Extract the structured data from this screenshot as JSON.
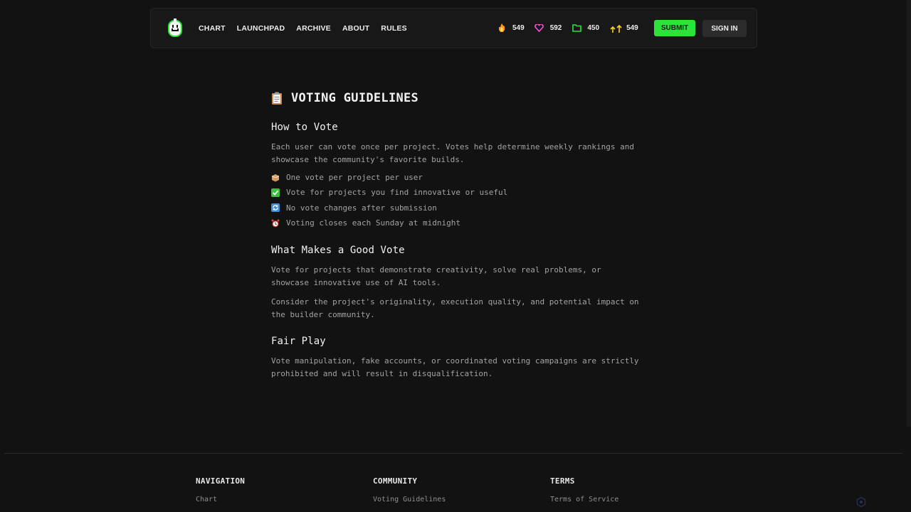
{
  "nav": {
    "logo_icon": "pixel-smiley-logo",
    "links": [
      "CHART",
      "LAUNCHPAD",
      "ARCHIVE",
      "ABOUT",
      "RULES"
    ],
    "stats": [
      {
        "icon": "fire-icon",
        "value": "549",
        "color": "#ff9a1a"
      },
      {
        "icon": "heart-icon",
        "value": "592",
        "color": "#ff4fd8"
      },
      {
        "icon": "folder-icon",
        "value": "450",
        "color": "#2ce33a"
      },
      {
        "icon": "up-arrows-icon",
        "value": "549",
        "color": "#ffd21a"
      }
    ],
    "submit_label": "SUBMIT",
    "signin_label": "SIGN IN",
    "accent_color": "#2ce33a"
  },
  "main": {
    "title": "VOTING GUIDELINES",
    "title_icon": "clipboard-icon",
    "how_to_vote": {
      "heading": "How to Vote",
      "text": "Each user can vote once per project. Votes help determine weekly rankings and showcase the community's favorite builds.",
      "bullets": [
        {
          "icon": "box-icon",
          "text": "One vote per project per user"
        },
        {
          "icon": "check-icon",
          "text": "Vote for projects you find innovative or useful"
        },
        {
          "icon": "refresh-icon",
          "text": "No vote changes after submission"
        },
        {
          "icon": "alarm-clock-icon",
          "text": "Voting closes each Sunday at midnight"
        }
      ]
    },
    "good_vote": {
      "heading": "What Makes a Good Vote",
      "text1": "Vote for projects that demonstrate creativity, solve real problems, or showcase innovative use of AI tools.",
      "text2": "Consider the project's originality, execution quality, and potential impact on the builder community."
    },
    "fair_play": {
      "heading": "Fair Play",
      "text": "Vote manipulation, fake accounts, or coordinated voting campaigns are strictly prohibited and will result in disqualification."
    }
  },
  "footer": {
    "columns": [
      {
        "heading": "NAVIGATION",
        "link": "Chart"
      },
      {
        "heading": "COMMUNITY",
        "link": "Voting Guidelines"
      },
      {
        "heading": "TERMS",
        "link": "Terms of Service"
      }
    ]
  }
}
